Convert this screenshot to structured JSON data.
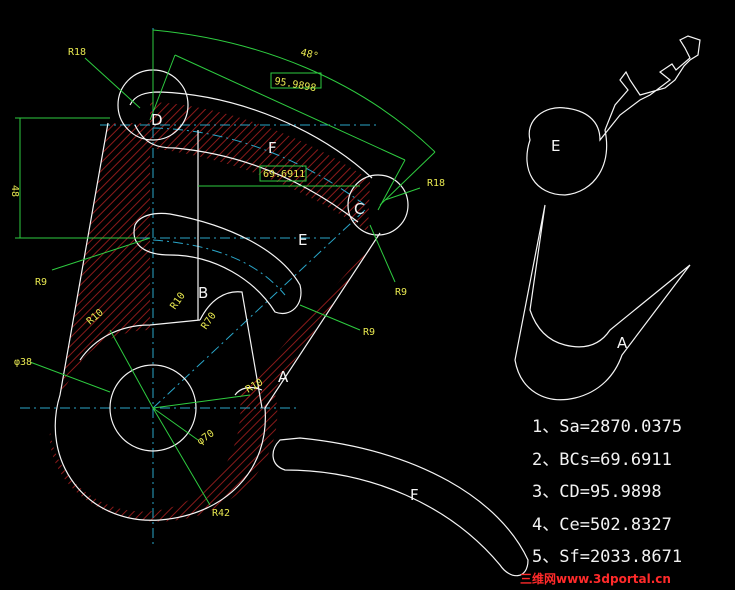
{
  "colors": {
    "background": "#000000",
    "outline": "#f5f5f5",
    "dimension": "#2ecc40",
    "centerline": "#2aa6c9",
    "label": "#e8e850",
    "hatch": "#8b1a1a",
    "watermark": "#ff2a2a"
  },
  "drawing": {
    "radius_labels": {
      "r18_top": "R18",
      "r18_right": "R18",
      "r9_left": "R9",
      "r9_right_a": "R9",
      "r9_right_b": "R9",
      "r10_a": "R10",
      "r10_b": "R10",
      "r70": "R70",
      "r10_c": "R10",
      "r42": "R42"
    },
    "diameter_labels": {
      "d38": "φ38",
      "d70": "φ70"
    },
    "linear_dims": {
      "dim_48_vertical": "48",
      "dim_angle": "48°",
      "dim_cd": "95.9898",
      "dim_bc": "69.6911"
    },
    "points": {
      "d": "D",
      "c": "C",
      "b": "B",
      "f_main": "F",
      "e_main": "E",
      "a_main": "A"
    },
    "part_labels": {
      "e_part": "E",
      "a_part": "A",
      "f_part": "F"
    }
  },
  "results": [
    "1、Sa=2870.0375",
    "2、BCs=69.6911",
    "3、CD=95.9898",
    "4、Ce=502.8327",
    "5、Sf=2033.8671"
  ],
  "watermark": "三维网www.3dportal.cn"
}
